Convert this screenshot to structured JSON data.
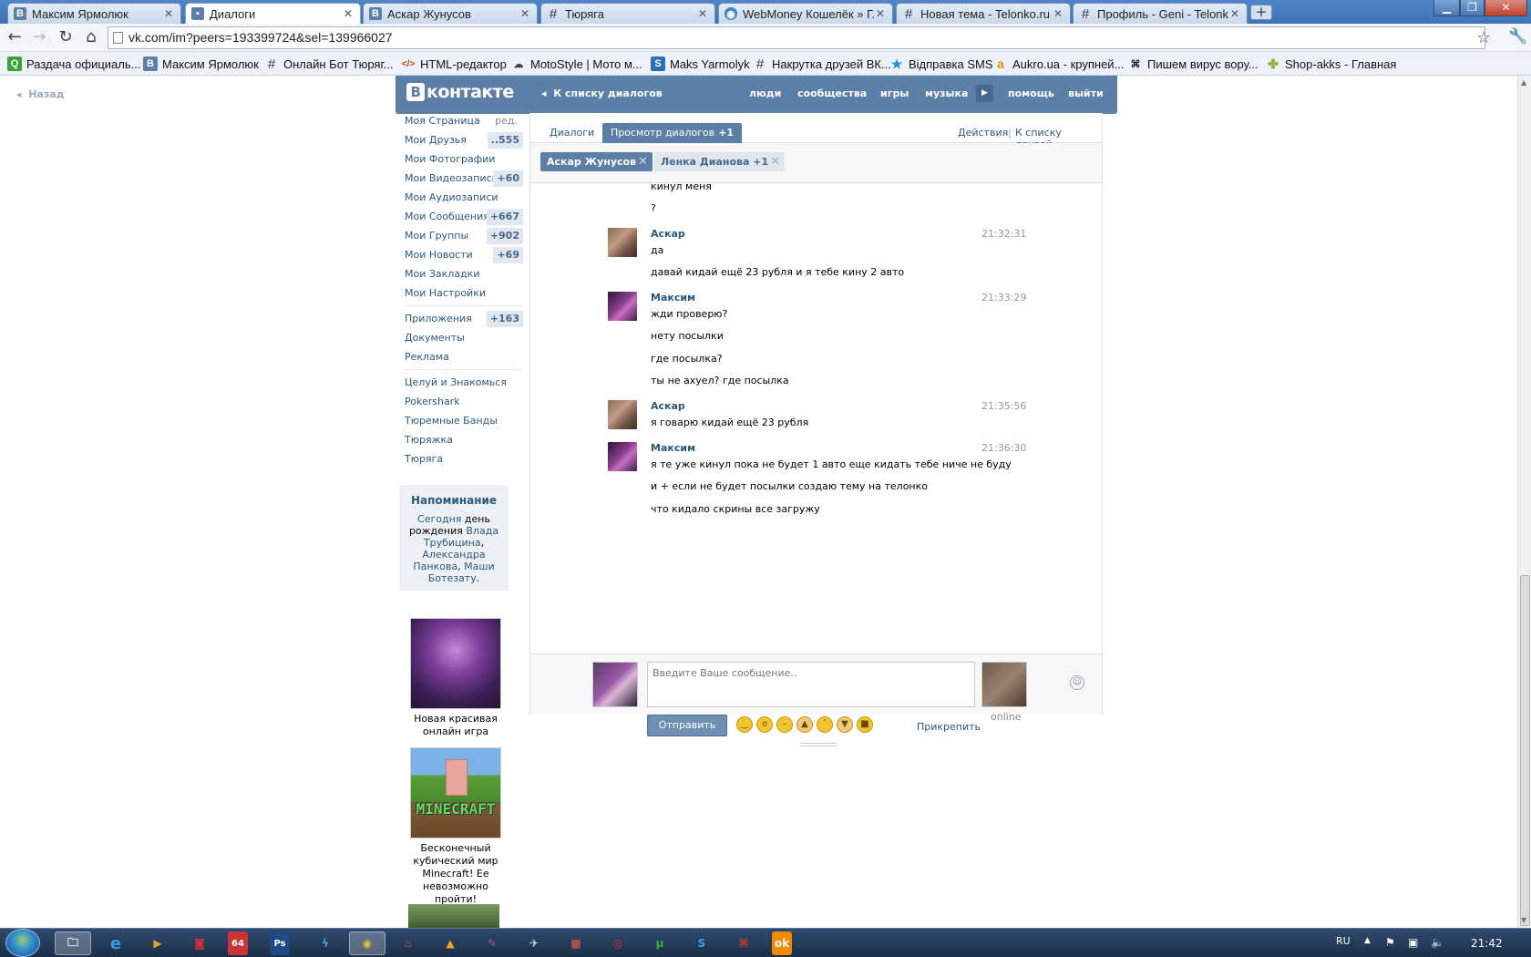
{
  "browser": {
    "tabs": [
      {
        "title": "Максим Ярмолюк",
        "icon": "vk-icon"
      },
      {
        "title": "Диалоги",
        "icon": "vk-dialogs-icon",
        "active": true
      },
      {
        "title": "Аскар Жунусов",
        "icon": "vk-icon"
      },
      {
        "title": "Тюряга",
        "icon": "hash-icon"
      },
      {
        "title": "WebMoney Кошелёк » Гла",
        "icon": "webmoney-icon"
      },
      {
        "title": "Новая тема - Telonko.ru",
        "icon": "hash-icon"
      },
      {
        "title": "Профиль - Geni - Telonko.",
        "icon": "hash-icon"
      }
    ],
    "new_tab": "+",
    "url": "vk.com/im?peers=193399724&sel=139966027",
    "bookmarks": [
      {
        "label": "Раздача официаль...",
        "icon": "q-icon",
        "color": "#3aa335"
      },
      {
        "label": "Максим Ярмолюк",
        "icon": "vk-icon",
        "color": "#5b7fa6"
      },
      {
        "label": "Онлайн Бот Тюряг...",
        "icon": "hash-icon",
        "color": "#333333"
      },
      {
        "label": "HTML-редактор",
        "icon": "html-icon",
        "color": "#cc4400"
      },
      {
        "label": "MotoStyle | Мото м...",
        "icon": "moto-icon",
        "color": "#444444"
      },
      {
        "label": "Maks Yarmolyk",
        "icon": "s-icon",
        "color": "#2a6fb8"
      },
      {
        "label": "Накрутка друзей ВК...",
        "icon": "hash-icon",
        "color": "#333333"
      },
      {
        "label": "Відправка SMS",
        "icon": "star-icon",
        "color": "#2a8fd8"
      },
      {
        "label": "Aukro.ua - крупней...",
        "icon": "aukro-icon",
        "color": "#f08a00"
      },
      {
        "label": "Пишем вирус вору...",
        "icon": "code-icon",
        "color": "#222222"
      },
      {
        "label": "Shop-akks - Главная",
        "icon": "android-icon",
        "color": "#8ab53a"
      }
    ]
  },
  "vk": {
    "back": "Назад",
    "logo": "контакте",
    "logo_b": "В",
    "to_list": "К списку диалогов",
    "nav": [
      "люди",
      "сообщества",
      "игры",
      "музыка",
      "помощь",
      "выйти"
    ],
    "menu": [
      {
        "label": "Моя Страница",
        "extra": "ред."
      },
      {
        "label": "Мои Друзья",
        "count": "..555"
      },
      {
        "label": "Мои Фотографии"
      },
      {
        "label": "Мои Видеозаписи",
        "count": "+60"
      },
      {
        "label": "Мои Аудиозаписи"
      },
      {
        "label": "Мои Сообщения",
        "count": "+667"
      },
      {
        "label": "Мои Группы",
        "count": "+902"
      },
      {
        "label": "Мои Новости",
        "count": "+69"
      },
      {
        "label": "Мои Закладки"
      },
      {
        "label": "Мои Настройки"
      },
      {
        "label": "Приложения",
        "count": "+163"
      },
      {
        "label": "Документы"
      },
      {
        "label": "Реклама"
      },
      {
        "label": "Целуй и Знакомься"
      },
      {
        "label": "Pokershark"
      },
      {
        "label": "Тюремные Банды"
      },
      {
        "label": "Тюряжка"
      },
      {
        "label": "Тюряга"
      }
    ],
    "reminder": {
      "title": "Напоминание",
      "today": "Сегодня",
      "text": "день рождения",
      "people": [
        "Влада Трубицина",
        "Александра Панкова",
        "Маши Ботезату"
      ]
    },
    "ads": [
      {
        "text": "Новая красивая онлайн игра"
      },
      {
        "text": "Бесконечный кубический мир Minecraft! Ее невозможно пройти!",
        "image_text": "MINECRAFT"
      }
    ]
  },
  "dialog": {
    "tabs": {
      "dialogs": "Диалоги",
      "view": "Просмотр диалогов",
      "view_count": "+1"
    },
    "actions": "Действия",
    "separator": "|",
    "friends_list": "К списку друзей",
    "chips": [
      {
        "label": "Аскар Жунусов"
      },
      {
        "label": "Ленка Дианова",
        "extra": "+1"
      }
    ],
    "history": [
      {
        "author": "",
        "time": "",
        "lines": [
          "кинул меня",
          "?"
        ]
      },
      {
        "author": "Аскар",
        "time": "21:32:31",
        "lines": [
          "да",
          "давай кидай ещё 23 рубля и я тебе кину 2 авто"
        ]
      },
      {
        "author": "Максим",
        "time": "21:33:29",
        "lines": [
          "жди проверю?",
          "нету посылки",
          "где посылка?",
          "ты не ахуел? где посылка"
        ]
      },
      {
        "author": "Аскар",
        "time": "21:35:56",
        "lines": [
          "я говарю кидай ещё 23 рубля"
        ]
      },
      {
        "author": "Максим",
        "time": "21:36:30",
        "lines": [
          "я те уже кинул пока не будет 1 авто еще кидать тебе ниче не буду",
          "и + если не будет посылки создаю тему на телонко",
          "что кидало скрины все загружу"
        ]
      }
    ],
    "compose": {
      "placeholder": "Введите Ваше сообщение..",
      "send": "Отправить",
      "attach": "Прикрепить",
      "status": "online"
    }
  },
  "taskbar": {
    "lang": "RU",
    "clock": "21:42"
  }
}
